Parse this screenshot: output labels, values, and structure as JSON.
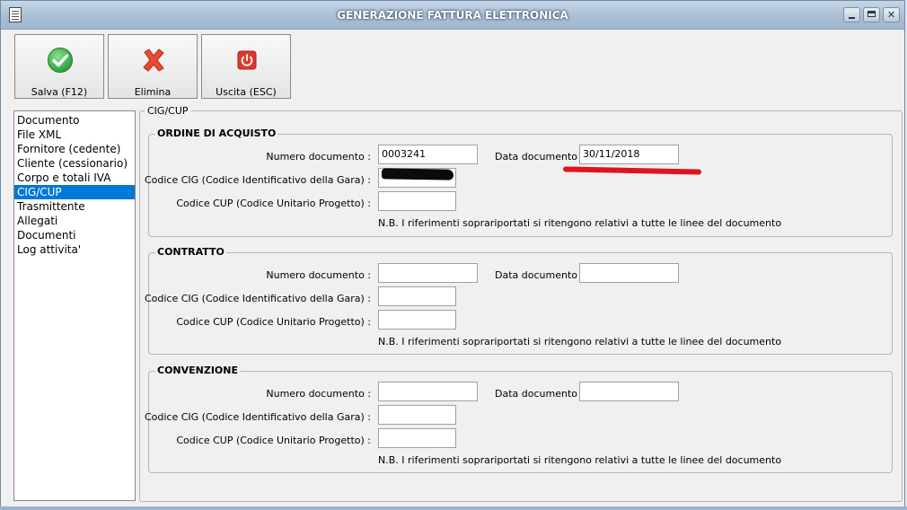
{
  "window": {
    "title": "GENERAZIONE FATTURA ELETTRONICA",
    "controls": {
      "minimize": "minimize-icon",
      "maximize": "maximize-icon",
      "close": "✕"
    }
  },
  "toolbar": {
    "save_label": "Salva (F12)",
    "delete_label": "Elimina",
    "exit_label": "Uscita (ESC)",
    "icons": {
      "save": "checkmark-icon",
      "delete": "red-x-icon",
      "exit": "power-icon"
    },
    "colors": {
      "save": "#39b54a",
      "delete": "#e8402a",
      "exit": "#d9362b"
    }
  },
  "nav": {
    "items": [
      "Documento",
      "File XML",
      "Fornitore (cedente)",
      "Cliente (cessionario)",
      "Corpo e totali IVA",
      "CIG/CUP",
      "Trasmittente",
      "Allegati",
      "Documenti",
      "Log attivita'"
    ],
    "selected": "CIG/CUP",
    "selected_color": "#0078d7"
  },
  "main": {
    "title": "CIG/CUP",
    "labels": {
      "numero": "Numero documento :",
      "data": "Data documento :",
      "cig": "Codice CIG (Codice Identificativo della Gara) :",
      "cup": "Codice CUP (Codice Unitario Progetto) :"
    },
    "note": "N.B. I riferimenti soprariportati si ritengono relativi a tutte le linee del documento",
    "groups": [
      {
        "title": "ORDINE DI ACQUISTO",
        "numero": "0003241",
        "data": "30/11/2018",
        "cig": "",
        "cup": ""
      },
      {
        "title": "CONTRATTO",
        "numero": "",
        "data": "",
        "cig": "",
        "cup": ""
      },
      {
        "title": "CONVENZIONE",
        "numero": "",
        "data": "",
        "cig": "",
        "cup": ""
      }
    ]
  },
  "annotations": {
    "cig_redacted": true,
    "date_underline_color": "#e1141e"
  }
}
